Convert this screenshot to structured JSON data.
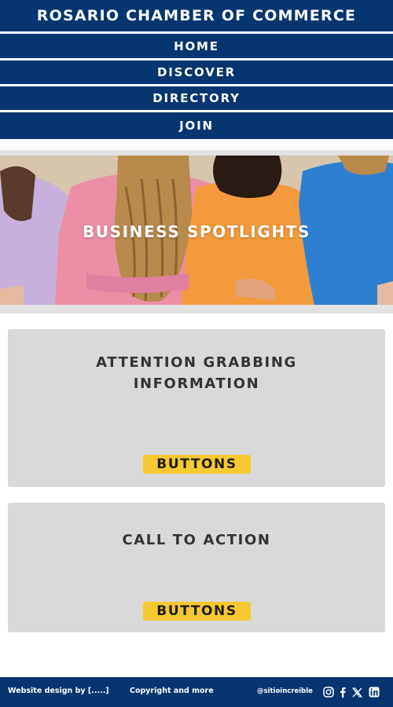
{
  "header": {
    "title": "ROSARIO CHAMBER OF COMMERCE",
    "nav": [
      {
        "label": "HOME"
      },
      {
        "label": "DISCOVER"
      },
      {
        "label": "DIRECTORY"
      },
      {
        "label": "JOIN"
      }
    ]
  },
  "hero": {
    "title": "BUSINESS SPOTLIGHTS"
  },
  "cards": [
    {
      "heading_line1": "ATTENTION GRABBING",
      "heading_line2": "INFORMATION",
      "button": "BUTTONS"
    },
    {
      "heading_line1": "CALL TO ACTION",
      "button": "BUTTONS"
    }
  ],
  "footer": {
    "credit": "Website design by [.....]",
    "copyright": "Copyright and more",
    "handle": "@sitioincreible",
    "social_icons": [
      "instagram-icon",
      "facebook-icon",
      "x-icon",
      "linkedin-icon"
    ]
  },
  "colors": {
    "primary": "#063570",
    "button": "#f7c930",
    "card": "#d9d9d9"
  }
}
